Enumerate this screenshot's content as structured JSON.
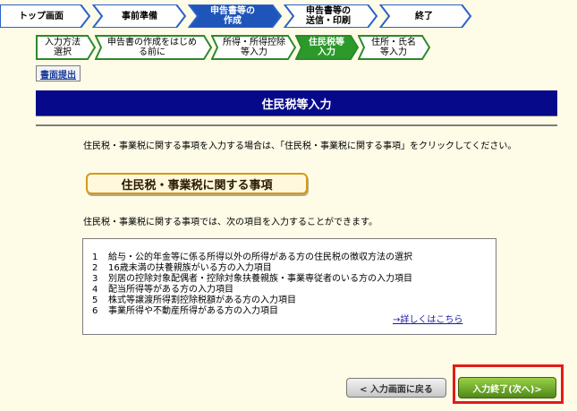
{
  "steps": [
    {
      "label": "トップ画面",
      "state": "normal"
    },
    {
      "label": "事前準備",
      "state": "normal"
    },
    {
      "label": "申告書等の\n作成",
      "state": "active"
    },
    {
      "label": "申告書等の\n送信・印刷",
      "state": "normal"
    },
    {
      "label": "終了",
      "state": "normal"
    }
  ],
  "substeps": [
    {
      "label": "入力方法\n選択",
      "state": "done"
    },
    {
      "label": "申告書の作成をはじめ\nる前に",
      "state": "done"
    },
    {
      "label": "所得・所得控除\n等入力",
      "state": "done"
    },
    {
      "label": "住民税等\n入力",
      "state": "active"
    },
    {
      "label": "住所・氏名\n等入力",
      "state": "normal"
    }
  ],
  "submit_label": "書面提出",
  "page_title": "住民税等入力",
  "intro_text": "住民税・事業税に関する事項を入力する場合は、「住民税・事業税に関する事項」をクリックしてください。",
  "main_button_label": "住民税・事業税に関する事項",
  "items_intro": "住民税・事業税に関する事項では、次の項目を入力することができます。",
  "items": [
    {
      "num": "1",
      "text": "給与・公的年金等に係る所得以外の所得がある方の住民税の徴収方法の選択"
    },
    {
      "num": "2",
      "text": "16歳未満の扶養親族がいる方の入力項目"
    },
    {
      "num": "3",
      "text": "別居の控除対象配偶者・控除対象扶養親族・事業専従者のいる方の入力項目"
    },
    {
      "num": "4",
      "text": "配当所得等がある方の入力項目"
    },
    {
      "num": "5",
      "text": "株式等譲渡所得割控除税額がある方の入力項目"
    },
    {
      "num": "6",
      "text": "事業所得や不動産所得がある方の入力項目"
    }
  ],
  "detail_link": "→詳しくはこちら",
  "back_label": "< 入力画面に戻る",
  "next_label": "入力終了(次へ)>",
  "colors": {
    "active_step": "#1f55b8",
    "step_border": "#2a62c9",
    "sub_done": "#ffffff",
    "sub_active": "#2b9a2b",
    "sub_border": "#2b8a2b",
    "title_bg": "#060a8a",
    "highlight": "#e31b1b"
  }
}
